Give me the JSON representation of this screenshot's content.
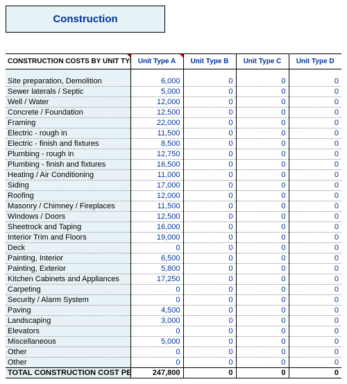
{
  "title": "Construction",
  "header": {
    "rowlabel": "CONSTRUCTION COSTS BY UNIT TYPE",
    "units": [
      "Unit Type A",
      "Unit Type B",
      "Unit Type C",
      "Unit Type D"
    ]
  },
  "rows": [
    {
      "label": "Site preparation, Demolition",
      "v": [
        "6,000",
        "0",
        "0",
        "0"
      ]
    },
    {
      "label": "Sewer laterals / Septic",
      "v": [
        "5,000",
        "0",
        "0",
        "0"
      ]
    },
    {
      "label": "Well / Water",
      "v": [
        "12,000",
        "0",
        "0",
        "0"
      ]
    },
    {
      "label": "Concrete / Foundation",
      "v": [
        "12,500",
        "0",
        "0",
        "0"
      ]
    },
    {
      "label": "Framing",
      "v": [
        "22,000",
        "0",
        "0",
        "0"
      ]
    },
    {
      "label": "Electric - rough in",
      "v": [
        "11,500",
        "0",
        "0",
        "0"
      ]
    },
    {
      "label": "Electric - finish and fixtures",
      "v": [
        "8,500",
        "0",
        "0",
        "0"
      ]
    },
    {
      "label": "Plumbing - rough in",
      "v": [
        "12,750",
        "0",
        "0",
        "0"
      ]
    },
    {
      "label": "Plumbing - finish and fixtures",
      "v": [
        "16,500",
        "0",
        "0",
        "0"
      ]
    },
    {
      "label": "Heating / Air Conditioning",
      "v": [
        "11,000",
        "0",
        "0",
        "0"
      ]
    },
    {
      "label": "Siding",
      "v": [
        "17,000",
        "0",
        "0",
        "0"
      ]
    },
    {
      "label": "Roofing",
      "v": [
        "12,000",
        "0",
        "0",
        "0"
      ]
    },
    {
      "label": "Masonry / Chimney / Fireplaces",
      "v": [
        "11,500",
        "0",
        "0",
        "0"
      ]
    },
    {
      "label": "Windows / Doors",
      "v": [
        "12,500",
        "0",
        "0",
        "0"
      ]
    },
    {
      "label": "Sheetrock and Taping",
      "v": [
        "16,000",
        "0",
        "0",
        "0"
      ]
    },
    {
      "label": "Interior Trim and Floors",
      "v": [
        "19,000",
        "0",
        "0",
        "0"
      ]
    },
    {
      "label": "Deck",
      "v": [
        "0",
        "0",
        "0",
        "0"
      ]
    },
    {
      "label": "Painting, Interior",
      "v": [
        "6,500",
        "0",
        "0",
        "0"
      ]
    },
    {
      "label": "Painting, Exterior",
      "v": [
        "5,800",
        "0",
        "0",
        "0"
      ]
    },
    {
      "label": "Kitchen Cabinets and Appliances",
      "v": [
        "17,250",
        "0",
        "0",
        "0"
      ]
    },
    {
      "label": "Carpeting",
      "v": [
        "0",
        "0",
        "0",
        "0"
      ]
    },
    {
      "label": "Security / Alarm System",
      "v": [
        "0",
        "0",
        "0",
        "0"
      ]
    },
    {
      "label": "Paving",
      "v": [
        "4,500",
        "0",
        "0",
        "0"
      ]
    },
    {
      "label": "Landscaping",
      "v": [
        "3,000",
        "0",
        "0",
        "0"
      ]
    },
    {
      "label": "Elevators",
      "v": [
        "0",
        "0",
        "0",
        "0"
      ]
    },
    {
      "label": "Miscellaneous",
      "v": [
        "5,000",
        "0",
        "0",
        "0"
      ]
    },
    {
      "label": "Other",
      "v": [
        "0",
        "0",
        "0",
        "0"
      ]
    },
    {
      "label": "Other",
      "v": [
        "0",
        "0",
        "0",
        "0"
      ]
    }
  ],
  "total": {
    "label": "TOTAL CONSTRUCTION COST PER UNIT:",
    "v": [
      "247,800",
      "0",
      "0",
      "0"
    ]
  }
}
